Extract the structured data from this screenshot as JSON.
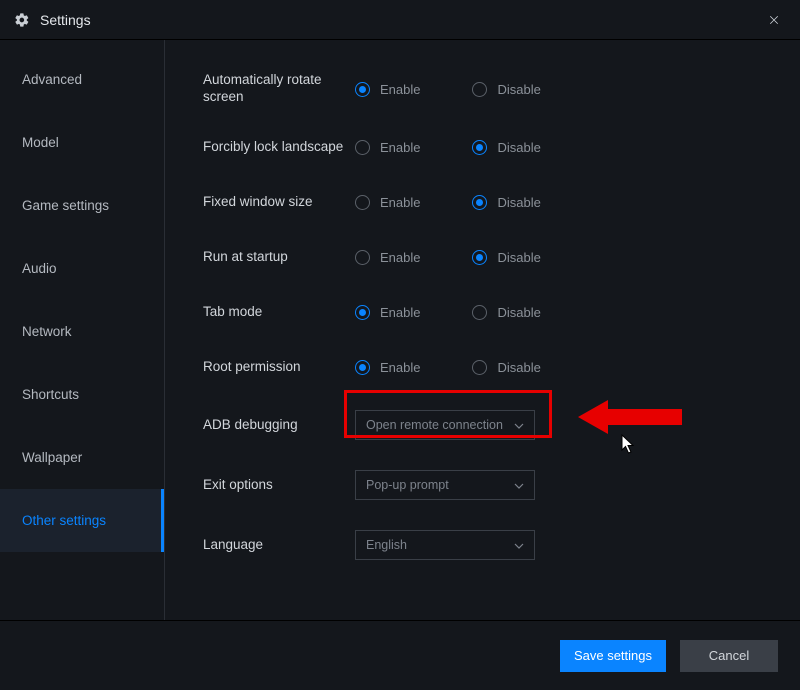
{
  "titlebar": {
    "title": "Settings"
  },
  "sidebar": {
    "items": [
      {
        "label": "Advanced"
      },
      {
        "label": "Model"
      },
      {
        "label": "Game settings"
      },
      {
        "label": "Audio"
      },
      {
        "label": "Network"
      },
      {
        "label": "Shortcuts"
      },
      {
        "label": "Wallpaper"
      },
      {
        "label": "Other settings"
      }
    ],
    "selected_index": 7
  },
  "settings": {
    "rows": [
      {
        "label": "Automatically rotate screen",
        "type": "radio",
        "options": [
          "Enable",
          "Disable"
        ],
        "value": "Enable"
      },
      {
        "label": "Forcibly lock landscape",
        "type": "radio",
        "options": [
          "Enable",
          "Disable"
        ],
        "value": "Disable"
      },
      {
        "label": "Fixed window size",
        "type": "radio",
        "options": [
          "Enable",
          "Disable"
        ],
        "value": "Disable"
      },
      {
        "label": "Run at startup",
        "type": "radio",
        "options": [
          "Enable",
          "Disable"
        ],
        "value": "Disable"
      },
      {
        "label": "Tab mode",
        "type": "radio",
        "options": [
          "Enable",
          "Disable"
        ],
        "value": "Enable"
      },
      {
        "label": "Root permission",
        "type": "radio",
        "options": [
          "Enable",
          "Disable"
        ],
        "value": "Enable"
      },
      {
        "label": "ADB debugging",
        "type": "select",
        "value": "Open remote connection"
      },
      {
        "label": "Exit options",
        "type": "select",
        "value": "Pop-up prompt"
      },
      {
        "label": "Language",
        "type": "select",
        "value": "English"
      }
    ]
  },
  "footer": {
    "save": "Save settings",
    "cancel": "Cancel"
  },
  "annotation": {
    "highlight_row_index": 6
  }
}
